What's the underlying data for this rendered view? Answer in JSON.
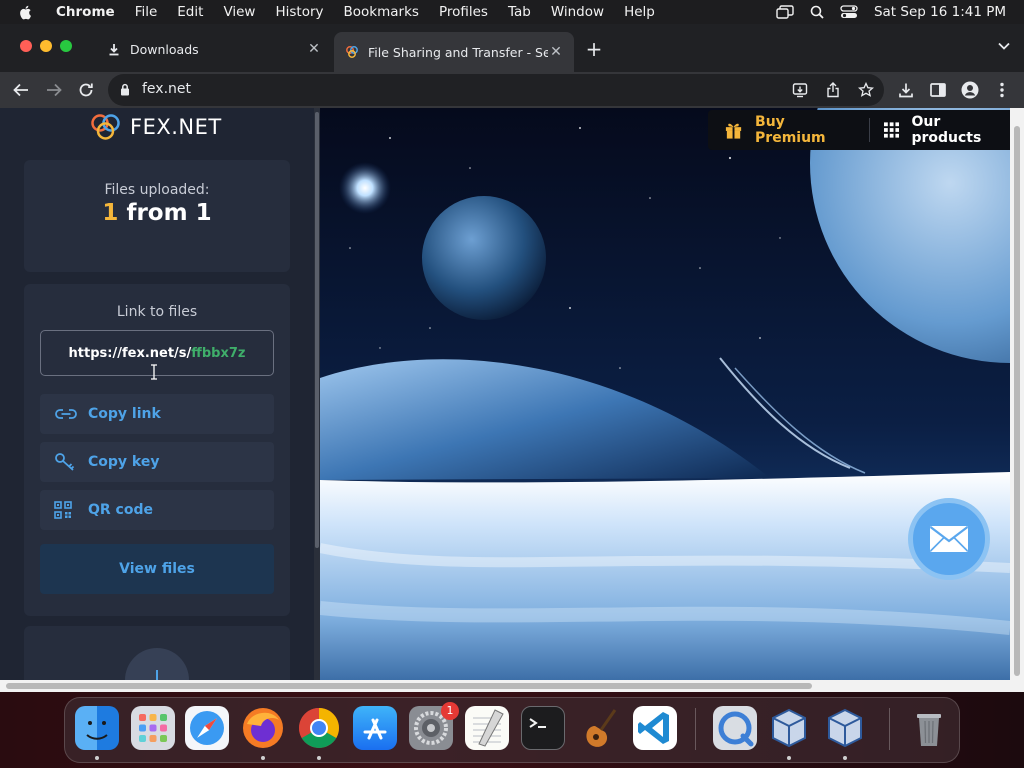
{
  "menubar": {
    "app_name": "Chrome",
    "items": [
      "File",
      "Edit",
      "View",
      "History",
      "Bookmarks",
      "Profiles",
      "Tab",
      "Window",
      "Help"
    ],
    "clock": "Sat Sep 16  1:41 PM"
  },
  "tabs": [
    {
      "label": "Downloads",
      "icon": "download-icon",
      "active": false
    },
    {
      "label": "File Sharing and Transfer - Sen",
      "icon": "fex-favicon",
      "active": true
    }
  ],
  "address_bar": {
    "url": "fex.net"
  },
  "sidebar": {
    "logo_text": "FEX.NET",
    "files_uploaded": {
      "label": "Files uploaded:",
      "uploaded": "1",
      "rest": " from 1"
    },
    "link_card": {
      "label": "Link to files",
      "url_prefix": "https://fex.net/s/",
      "url_code": "ffbbx7z",
      "copy_link": "Copy link",
      "copy_key": "Copy key",
      "qr_code": "QR code",
      "view_files": "View files"
    }
  },
  "hero": {
    "buy_premium": "Buy Premium",
    "our_products": "Our products"
  },
  "dock": {
    "apps": [
      "Finder",
      "Launchpad",
      "Safari",
      "Firefox",
      "Chrome",
      "App Store",
      "System Settings",
      "TextEdit",
      "Terminal",
      "GarageBand",
      "Visual Studio Code",
      "QuickTime Player",
      "VirtualBox",
      "VirtualBox VM",
      "Trash"
    ],
    "settings_badge": "1"
  },
  "colors": {
    "accent_blue": "#4ea3e8",
    "accent_gold": "#f4b63b",
    "link_code_green": "#3fae6a"
  }
}
